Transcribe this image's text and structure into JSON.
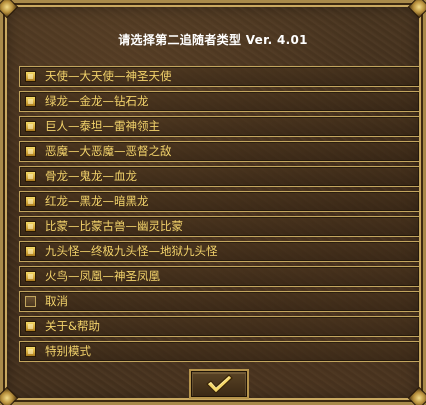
{
  "dialog": {
    "title": "请选择第二追随者类型  Ver. 4.01"
  },
  "menu": {
    "items": [
      {
        "label": "天使—大天使—神圣天使",
        "icon": "filled-square-icon"
      },
      {
        "label": "绿龙—金龙—钻石龙",
        "icon": "filled-square-icon"
      },
      {
        "label": "巨人—泰坦—雷神领主",
        "icon": "filled-square-icon"
      },
      {
        "label": "恶魔—大恶魔—恶督之敌",
        "icon": "filled-square-icon"
      },
      {
        "label": "骨龙—鬼龙—血龙",
        "icon": "filled-square-icon"
      },
      {
        "label": "红龙—黑龙—暗黑龙",
        "icon": "filled-square-icon"
      },
      {
        "label": "比蒙—比蒙古兽—幽灵比蒙",
        "icon": "filled-square-icon"
      },
      {
        "label": "九头怪—终极九头怪—地狱九头怪",
        "icon": "filled-square-icon"
      },
      {
        "label": "火鸟—凤凰—神圣凤凰",
        "icon": "filled-square-icon"
      },
      {
        "label": "取消",
        "icon": "empty-square-icon"
      },
      {
        "label": "关于&帮助",
        "icon": "filled-square-icon"
      },
      {
        "label": "特别模式",
        "icon": "filled-square-icon"
      }
    ]
  },
  "ok_button": {
    "icon": "checkmark-icon"
  },
  "colors": {
    "label_text": "#f3d36b",
    "title_text": "#ffffff",
    "border_gold": "#c2a55e",
    "panel_brown": "#4a3520"
  }
}
